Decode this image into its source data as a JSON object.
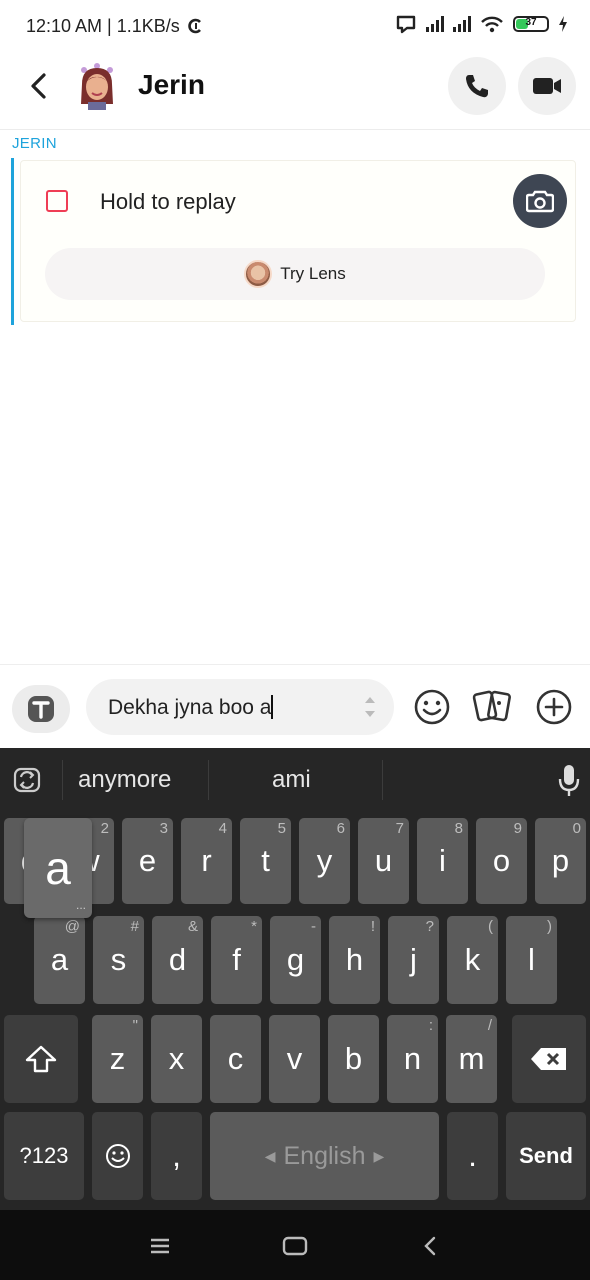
{
  "status_bar": {
    "time_speed": "12:10 AM | 1.1KB/s",
    "battery": "37"
  },
  "header": {
    "title": "Jerin"
  },
  "chat": {
    "sender": "JERIN",
    "message_label": "Hold to replay",
    "lens_button_label": "Try Lens"
  },
  "input": {
    "value": "Dekha jyna boo a"
  },
  "keyboard": {
    "suggestions": [
      "anymore",
      "ami"
    ],
    "row1": [
      {
        "key": "q",
        "alt": "1"
      },
      {
        "key": "w",
        "alt": "2"
      },
      {
        "key": "e",
        "alt": "3"
      },
      {
        "key": "r",
        "alt": "4"
      },
      {
        "key": "t",
        "alt": "5"
      },
      {
        "key": "y",
        "alt": "6"
      },
      {
        "key": "u",
        "alt": "7"
      },
      {
        "key": "i",
        "alt": "8"
      },
      {
        "key": "o",
        "alt": "9"
      },
      {
        "key": "p",
        "alt": "0"
      }
    ],
    "row2": [
      {
        "key": "a",
        "alt": "@"
      },
      {
        "key": "s",
        "alt": "#"
      },
      {
        "key": "d",
        "alt": "&"
      },
      {
        "key": "f",
        "alt": "*"
      },
      {
        "key": "g",
        "alt": "-"
      },
      {
        "key": "h",
        "alt": "!"
      },
      {
        "key": "j",
        "alt": "?"
      },
      {
        "key": "k",
        "alt": "("
      },
      {
        "key": "l",
        "alt": ")"
      }
    ],
    "row3": [
      {
        "key": "z",
        "alt": "\""
      },
      {
        "key": "x",
        "alt": ""
      },
      {
        "key": "c",
        "alt": ""
      },
      {
        "key": "v",
        "alt": ""
      },
      {
        "key": "b",
        "alt": ""
      },
      {
        "key": "n",
        "alt": ":"
      },
      {
        "key": "m",
        "alt": "/"
      }
    ],
    "popup_key": "a",
    "symbols_label": "?123",
    "comma_label": ",",
    "space_label": "English",
    "period_label": ".",
    "send_label": "Send"
  },
  "colors": {
    "accent_blue": "#1ea3dc",
    "snap_red": "#ef3d55",
    "keyboard_bg": "#262626",
    "key_bg": "#5b5b5b"
  }
}
